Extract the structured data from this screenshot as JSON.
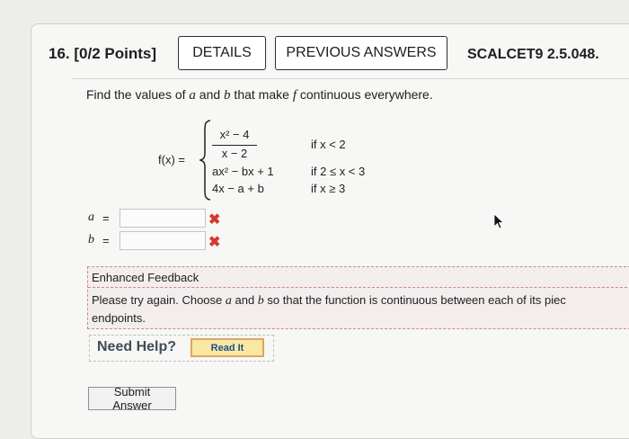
{
  "question": {
    "number": "16.",
    "points": "[0/2 Points]",
    "details_label": "DETAILS",
    "previous_answers_label": "PREVIOUS ANSWERS",
    "code": "SCALCET9 2.5.048."
  },
  "prompt": {
    "before": "Find the values of ",
    "var_a": "a",
    "and": " and ",
    "var_b": "b",
    "middle": " that make ",
    "var_f": "f",
    "after": " continuous everywhere."
  },
  "function": {
    "lhs": "f(x) =",
    "case1_numerator": "x² − 4",
    "case1_denominator": "x − 2",
    "case1_condition": "if x < 2",
    "case2_expression": "ax² − bx + 1",
    "case2_condition": "if 2 ≤ x < 3",
    "case3_expression": "4x − a + b",
    "case3_condition": "if x ≥ 3"
  },
  "answers": [
    {
      "label": "a",
      "equals": "=",
      "value": "",
      "status_icon": "x-mark-icon"
    },
    {
      "label": "b",
      "equals": "=",
      "value": "",
      "status_icon": "x-mark-icon"
    }
  ],
  "feedback": {
    "title": "Enhanced Feedback",
    "text_before": "Please try again. Choose ",
    "var_a": "a",
    "text_and": " and ",
    "var_b": "b",
    "text_after": " so that the function is continuous between each of its piec",
    "text_line2": "endpoints."
  },
  "help": {
    "label": "Need Help?",
    "read_it_label": "Read It"
  },
  "submit_label": "Submit Answer",
  "colors": {
    "error": "#d43a2b",
    "read_it_bg": "#f9e8a4",
    "read_it_border": "#e0a45c",
    "read_it_text": "#1d4f8b"
  }
}
